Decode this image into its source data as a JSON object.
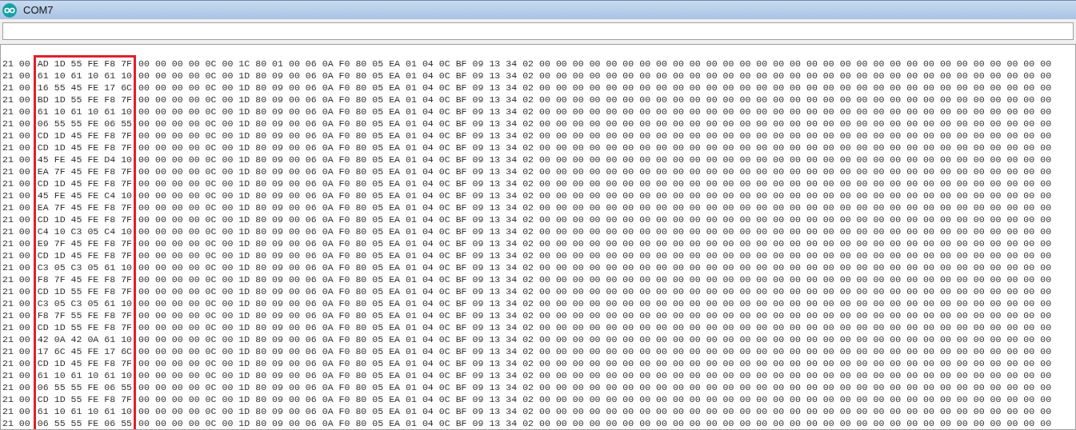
{
  "window": {
    "title": "COM7"
  },
  "rows": [
    {
      "head": "21 00",
      "marked": "AD 1D 55 FE F8 7F",
      "tail": "00 00 00 00 0C 00 1C 80 01 00 06 0A F0 80 05 EA 01 04 0C BF 09 13 34 02 00 00 00 00 00 00 00 00 00 00 00 00 00 00 00 00 00 00 00 00 00 00 00 00 00 00 00 00 00 00 00"
    },
    {
      "head": "21 00",
      "marked": "61 10 61 10 61 10",
      "tail": "00 00 00 00 0C 00 1D 80 09 00 06 0A F0 80 05 EA 01 04 0C BF 09 13 34 02 00 00 00 00 00 00 00 00 00 00 00 00 00 00 00 00 00 00 00 00 00 00 00 00 00 00 00 00 00 00 00"
    },
    {
      "head": "21 00",
      "marked": "16 55 45 FE 17 6C",
      "tail": "00 00 00 00 0C 00 1D 80 09 00 06 0A F0 80 05 EA 01 04 0C BF 09 13 34 02 00 00 00 00 00 00 00 00 00 00 00 00 00 00 00 00 00 00 00 00 00 00 00 00 00 00 00 00 00 00 00"
    },
    {
      "head": "21 00",
      "marked": "BD 1D 55 FE F8 7F",
      "tail": "00 00 00 00 0C 00 1D 80 09 00 06 0A F0 80 05 EA 01 04 0C BF 09 13 34 02 00 00 00 00 00 00 00 00 00 00 00 00 00 00 00 00 00 00 00 00 00 00 00 00 00 00 00 00 00 00 00"
    },
    {
      "head": "21 00",
      "marked": "61 10 61 10 61 10",
      "tail": "00 00 00 00 0C 00 1D 80 09 00 06 0A F0 80 05 EA 01 04 0C BF 09 13 34 02 00 00 00 00 00 00 00 00 00 00 00 00 00 00 00 00 00 00 00 00 00 00 00 00 00 00 00 00 00 00 00"
    },
    {
      "head": "21 00",
      "marked": "06 55 55 FE 06 55",
      "tail": "00 00 00 00 0C 00 1D 80 09 00 06 0A F0 80 05 EA 01 04 0C BF 09 13 34 02 00 00 00 00 00 00 00 00 00 00 00 00 00 00 00 00 00 00 00 00 00 00 00 00 00 00 00 00 00 00 00"
    },
    {
      "head": "21 00",
      "marked": "CD 1D 45 FE F8 7F",
      "tail": "00 00 00 00 0C 00 1D 80 09 00 06 0A F0 80 05 EA 01 04 0C BF 09 13 34 02 00 00 00 00 00 00 00 00 00 00 00 00 00 00 00 00 00 00 00 00 00 00 00 00 00 00 00 00 00 00 00"
    },
    {
      "head": "21 00",
      "marked": "CD 1D 45 FE F8 7F",
      "tail": "00 00 00 00 0C 00 1D 80 09 00 06 0A F0 80 05 EA 01 04 0C BF 09 13 34 02 00 00 00 00 00 00 00 00 00 00 00 00 00 00 00 00 00 00 00 00 00 00 00 00 00 00 00 00 00 00 00"
    },
    {
      "head": "21 00",
      "marked": "45 FE 45 FE D4 10",
      "tail": "00 00 00 00 0C 00 1D 80 09 00 06 0A F0 80 05 EA 01 04 0C BF 09 13 34 02 00 00 00 00 00 00 00 00 00 00 00 00 00 00 00 00 00 00 00 00 00 00 00 00 00 00 00 00 00 00 00"
    },
    {
      "head": "21 00",
      "marked": "EA 7F 45 FE F8 7F",
      "tail": "00 00 00 00 0C 00 1D 80 09 00 06 0A F0 80 05 EA 01 04 0C BF 09 13 34 02 00 00 00 00 00 00 00 00 00 00 00 00 00 00 00 00 00 00 00 00 00 00 00 00 00 00 00 00 00 00 00"
    },
    {
      "head": "21 00",
      "marked": "CD 1D 45 FE F8 7F",
      "tail": "00 00 00 00 0C 00 1D 80 09 00 06 0A F0 80 05 EA 01 04 0C BF 09 13 34 02 00 00 00 00 00 00 00 00 00 00 00 00 00 00 00 00 00 00 00 00 00 00 00 00 00 00 00 00 00 00 00"
    },
    {
      "head": "21 00",
      "marked": "45 FE 45 FE C4 10",
      "tail": "00 00 00 00 0C 00 1D 80 09 00 06 0A F0 80 05 EA 01 04 0C BF 09 13 34 02 00 00 00 00 00 00 00 00 00 00 00 00 00 00 00 00 00 00 00 00 00 00 00 00 00 00 00 00 00 00 00"
    },
    {
      "head": "21 00",
      "marked": "EA 7F 45 FE F8 7F",
      "tail": "00 00 00 00 0C 00 1D 80 09 00 06 0A F0 80 05 EA 01 04 0C BF 09 13 34 02 00 00 00 00 00 00 00 00 00 00 00 00 00 00 00 00 00 00 00 00 00 00 00 00 00 00 00 00 00 00 00"
    },
    {
      "head": "21 00",
      "marked": "CD 1D 45 FE F8 7F",
      "tail": "00 00 00 00 0C 00 1D 80 09 00 06 0A F0 80 05 EA 01 04 0C BF 09 13 34 02 00 00 00 00 00 00 00 00 00 00 00 00 00 00 00 00 00 00 00 00 00 00 00 00 00 00 00 00 00 00 00"
    },
    {
      "head": "21 00",
      "marked": "C4 10 C3 05 C4 10",
      "tail": "00 00 00 00 0C 00 1D 80 09 00 06 0A F0 80 05 EA 01 04 0C BF 09 13 34 02 00 00 00 00 00 00 00 00 00 00 00 00 00 00 00 00 00 00 00 00 00 00 00 00 00 00 00 00 00 00 00"
    },
    {
      "head": "21 00",
      "marked": "E9 7F 45 FE F8 7F",
      "tail": "00 00 00 00 0C 00 1D 80 09 00 06 0A F0 80 05 EA 01 04 0C BF 09 13 34 02 00 00 00 00 00 00 00 00 00 00 00 00 00 00 00 00 00 00 00 00 00 00 00 00 00 00 00 00 00 00 00"
    },
    {
      "head": "21 00",
      "marked": "CD 1D 45 FE F8 7F",
      "tail": "00 00 00 00 0C 00 1D 80 09 00 06 0A F0 80 05 EA 01 04 0C BF 09 13 34 02 00 00 00 00 00 00 00 00 00 00 00 00 00 00 00 00 00 00 00 00 00 00 00 00 00 00 00 00 00 00 00"
    },
    {
      "head": "21 00",
      "marked": "C3 05 C3 05 61 10",
      "tail": "00 00 00 00 0C 00 1D 80 09 00 06 0A F0 80 05 EA 01 04 0C BF 09 13 34 02 00 00 00 00 00 00 00 00 00 00 00 00 00 00 00 00 00 00 00 00 00 00 00 00 00 00 00 00 00 00 00"
    },
    {
      "head": "21 00",
      "marked": "F8 7F 45 FE F8 7F",
      "tail": "00 00 00 00 0C 00 1D 80 09 00 06 0A F0 80 05 EA 01 04 0C BF 09 13 34 02 00 00 00 00 00 00 00 00 00 00 00 00 00 00 00 00 00 00 00 00 00 00 00 00 00 00 00 00 00 00 00"
    },
    {
      "head": "21 00",
      "marked": "CD 1D 55 FE F8 7F",
      "tail": "00 00 00 00 0C 00 1D 80 09 00 06 0A F0 80 05 EA 01 04 0C BF 09 13 34 02 00 00 00 00 00 00 00 00 00 00 00 00 00 00 00 00 00 00 00 00 00 00 00 00 00 00 00 00 00 00 00"
    },
    {
      "head": "21 00",
      "marked": "C3 05 C3 05 61 10",
      "tail": "00 00 00 00 0C 00 1D 80 09 00 06 0A F0 80 05 EA 01 04 0C BF 09 13 34 02 00 00 00 00 00 00 00 00 00 00 00 00 00 00 00 00 00 00 00 00 00 00 00 00 00 00 00 00 00 00 00"
    },
    {
      "head": "21 00",
      "marked": "F8 7F 55 FE F8 7F",
      "tail": "00 00 00 00 0C 00 1D 80 09 00 06 0A F0 80 05 EA 01 04 0C BF 09 13 34 02 00 00 00 00 00 00 00 00 00 00 00 00 00 00 00 00 00 00 00 00 00 00 00 00 00 00 00 00 00 00 00"
    },
    {
      "head": "21 00",
      "marked": "CD 1D 55 FE F8 7F",
      "tail": "00 00 00 00 0C 00 1D 80 09 00 06 0A F0 80 05 EA 01 04 0C BF 09 13 34 02 00 00 00 00 00 00 00 00 00 00 00 00 00 00 00 00 00 00 00 00 00 00 00 00 00 00 00 00 00 00 00"
    },
    {
      "head": "21 00",
      "marked": "42 0A 42 0A 61 10",
      "tail": "00 00 00 00 0C 00 1D 80 09 00 06 0A F0 80 05 EA 01 04 0C BF 09 13 34 02 00 00 00 00 00 00 00 00 00 00 00 00 00 00 00 00 00 00 00 00 00 00 00 00 00 00 00 00 00 00 00"
    },
    {
      "head": "21 00",
      "marked": "17 6C 45 FE 17 6C",
      "tail": "00 00 00 00 0C 00 1D 80 09 00 06 0A F0 80 05 EA 01 04 0C BF 09 13 34 02 00 00 00 00 00 00 00 00 00 00 00 00 00 00 00 00 00 00 00 00 00 00 00 00 00 00 00 00 00 00 00"
    },
    {
      "head": "21 00",
      "marked": "CD 1D 45 FE F8 7F",
      "tail": "00 00 00 00 0C 00 1D 80 09 00 06 0A F0 80 05 EA 01 04 0C BF 09 13 34 02 00 00 00 00 00 00 00 00 00 00 00 00 00 00 00 00 00 00 00 00 00 00 00 00 00 00 00 00 00 00 00"
    },
    {
      "head": "21 00",
      "marked": "61 10 61 10 61 10",
      "tail": "00 00 00 00 0C 00 1D 80 09 00 06 0A F0 80 05 EA 01 04 0C BF 09 13 34 02 00 00 00 00 00 00 00 00 00 00 00 00 00 00 00 00 00 00 00 00 00 00 00 00 00 00 00 00 00 00 00"
    },
    {
      "head": "21 00",
      "marked": "06 55 55 FE 06 55",
      "tail": "00 00 00 00 0C 00 1D 80 09 00 06 0A F0 80 05 EA 01 04 0C BF 09 13 34 02 00 00 00 00 00 00 00 00 00 00 00 00 00 00 00 00 00 00 00 00 00 00 00 00 00 00 00 00 00 00 00"
    },
    {
      "head": "21 00",
      "marked": "CD 1D 55 FE F8 7F",
      "tail": "00 00 00 00 0C 00 1D 80 09 00 06 0A F0 80 05 EA 01 04 0C BF 09 13 34 02 00 00 00 00 00 00 00 00 00 00 00 00 00 00 00 00 00 00 00 00 00 00 00 00 00 00 00 00 00 00 00"
    },
    {
      "head": "21 00",
      "marked": "61 10 61 10 61 10",
      "tail": "00 00 00 00 0C 00 1D 80 09 00 06 0A F0 80 05 EA 01 04 0C BF 09 13 34 02 00 00 00 00 00 00 00 00 00 00 00 00 00 00 00 00 00 00 00 00 00 00 00 00 00 00 00 00 00 00 00"
    },
    {
      "head": "21 00",
      "marked": "06 55 55 FE 06 55",
      "tail": "00 00 00 00 0C 00 1D 80 09 00 06 0A F0 80 05 EA 01 04 0C BF 09 13 34 02 00 00 00 00 00 00 00 00 00 00 00 00 00 00 00 00 00 00 00 00 00 00 00 00 00 00 00 00 00 00 00"
    }
  ]
}
